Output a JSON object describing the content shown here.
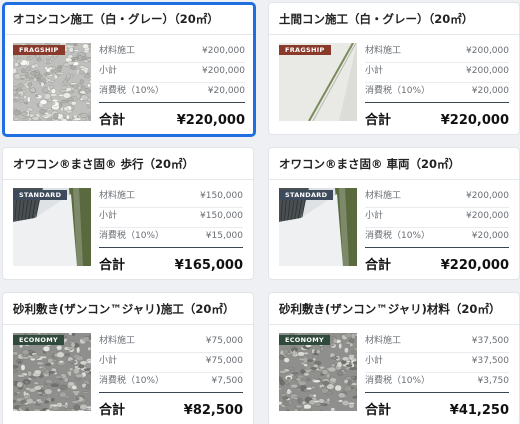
{
  "products": [
    {
      "title": "オコシコン施工（白・グレー）（20㎡）",
      "badge": "FRAGSHIP",
      "badge_color": "#8a3a2a",
      "image": "gravel-white",
      "rows": [
        {
          "label": "材料施工",
          "value": "¥200,000"
        },
        {
          "label": "小計",
          "value": "¥200,000"
        },
        {
          "label": "消費税（10%）",
          "value": "¥20,000"
        }
      ],
      "total_label": "合計",
      "total_value": "¥220,000",
      "selected": true
    },
    {
      "title": "土間コン施工（白・グレー）（20㎡）",
      "badge": "FRAGSHIP",
      "badge_color": "#8a3a2a",
      "image": "concrete-slab",
      "rows": [
        {
          "label": "材料施工",
          "value": "¥200,000"
        },
        {
          "label": "小計",
          "value": "¥200,000"
        },
        {
          "label": "消費税（10%）",
          "value": "¥20,000"
        }
      ],
      "total_label": "合計",
      "total_value": "¥220,000",
      "selected": false
    },
    {
      "title": "オワコン®まさ固® 歩行（20㎡）",
      "badge": "STANDARD",
      "badge_color": "#3d4a5c",
      "image": "walkway",
      "rows": [
        {
          "label": "材料施工",
          "value": "¥150,000"
        },
        {
          "label": "小計",
          "value": "¥150,000"
        },
        {
          "label": "消費税（10%）",
          "value": "¥15,000"
        }
      ],
      "total_label": "合計",
      "total_value": "¥165,000",
      "selected": false
    },
    {
      "title": "オワコン®まさ固® 車両（20㎡）",
      "badge": "STANDARD",
      "badge_color": "#3d4a5c",
      "image": "walkway",
      "rows": [
        {
          "label": "材料施工",
          "value": "¥200,000"
        },
        {
          "label": "小計",
          "value": "¥200,000"
        },
        {
          "label": "消費税（10%）",
          "value": "¥20,000"
        }
      ],
      "total_label": "合計",
      "total_value": "¥220,000",
      "selected": false
    },
    {
      "title": "砂利敷き(ザンコン™ジャリ)施工（20㎡）",
      "badge": "ECONOMY",
      "badge_color": "#2f4a3c",
      "image": "gravel-grey",
      "rows": [
        {
          "label": "材料施工",
          "value": "¥75,000"
        },
        {
          "label": "小計",
          "value": "¥75,000"
        },
        {
          "label": "消費税（10%）",
          "value": "¥7,500"
        }
      ],
      "total_label": "合計",
      "total_value": "¥82,500",
      "selected": false
    },
    {
      "title": "砂利敷き(ザンコン™ジャリ)材料（20㎡）",
      "badge": "ECONOMY",
      "badge_color": "#2f4a3c",
      "image": "gravel-grey",
      "rows": [
        {
          "label": "材料施工",
          "value": "¥37,500"
        },
        {
          "label": "小計",
          "value": "¥37,500"
        },
        {
          "label": "消費税（10%）",
          "value": "¥3,750"
        }
      ],
      "total_label": "合計",
      "total_value": "¥41,250",
      "selected": false
    }
  ]
}
